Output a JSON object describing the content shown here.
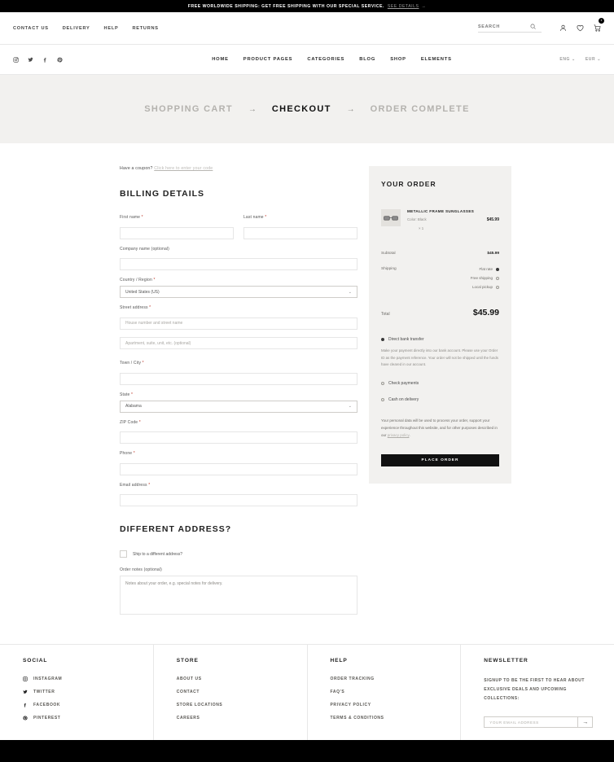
{
  "announcement": {
    "text": "FREE WORLDWIDE SHIPPING: GET FREE SHIPPING WITH OUR SPECIAL SERVICE.",
    "link": "SEE DETAILS",
    "arrow": "→"
  },
  "utility": {
    "links": [
      "CONTACT US",
      "DELIVERY",
      "HELP",
      "RETURNS"
    ],
    "search_placeholder": "SEARCH",
    "cart_count": "1"
  },
  "mainnav": {
    "social": [
      "instagram-icon",
      "twitter-icon",
      "facebook-icon",
      "pinterest-icon"
    ],
    "items": [
      "HOME",
      "PRODUCT PAGES",
      "CATEGORIES",
      "BLOG",
      "SHOP",
      "ELEMENTS"
    ],
    "language": "ENG",
    "currency": "EUR",
    "chevron": "⌄"
  },
  "steps": {
    "cart": "SHOPPING CART",
    "checkout": "CHECKOUT",
    "complete": "ORDER COMPLETE",
    "arrow": "→"
  },
  "coupon": {
    "prompt": "Have a coupon?",
    "link": "Click here to enter your code"
  },
  "billing": {
    "heading": "BILLING DETAILS",
    "first_name_label": "First name",
    "last_name_label": "Last name",
    "company_label": "Company name (optional)",
    "country_label": "Country / Region",
    "country_value": "United States (US)",
    "street_label": "Street address",
    "street1_placeholder": "House number and street name",
    "street2_placeholder": "Apartment, suite, unit, etc. (optional)",
    "city_label": "Town / City",
    "state_label": "State",
    "state_value": "Alabama",
    "zip_label": "ZIP Code",
    "phone_label": "Phone",
    "email_label": "Email address",
    "required_mark": "*"
  },
  "different_address": {
    "heading": "DIFFERENT ADDRESS?",
    "ship_label": "Ship to a different address?",
    "notes_label": "Order notes (optional)",
    "notes_placeholder": "Notes about your order, e.g. special notes for delivery."
  },
  "order": {
    "heading": "YOUR ORDER",
    "product": {
      "title": "METALLIC FRAME SUNGLASSES",
      "color": "Color: Black",
      "quantity": "× 1",
      "price": "$45.99"
    },
    "subtotal_label": "Subtotal",
    "subtotal_value": "$45.99",
    "shipping_label": "Shipping",
    "shipping_options": [
      {
        "label": "Flat rate",
        "selected": true
      },
      {
        "label": "Free shipping",
        "selected": false
      },
      {
        "label": "Local pickup",
        "selected": false
      }
    ],
    "total_label": "Total",
    "total_value": "$45.99",
    "payment_methods": [
      {
        "label": "Direct bank transfer",
        "selected": true
      },
      {
        "label": "Check payments",
        "selected": false
      },
      {
        "label": "Cash on delivery",
        "selected": false
      }
    ],
    "payment_description": "Make your payment directly into our bank account. Please use your Order ID as the payment reference. Your order will not be shipped until the funds have cleared in our account.",
    "privacy_text": "Your personal data will be used to process your order, support your experience throughout this website, and for other purposes described in our",
    "privacy_link": "privacy policy",
    "privacy_tail": ".",
    "place_order": "PLACE ORDER"
  },
  "footer": {
    "social": {
      "title": "SOCIAL",
      "items": [
        {
          "label": "INSTAGRAM",
          "icon": "instagram-icon"
        },
        {
          "label": "TWITTER",
          "icon": "twitter-icon"
        },
        {
          "label": "FACEBOOK",
          "icon": "facebook-icon"
        },
        {
          "label": "PINTEREST",
          "icon": "pinterest-icon"
        }
      ]
    },
    "store": {
      "title": "STORE",
      "items": [
        "ABOUT US",
        "CONTACT",
        "STORE LOCATIONS",
        "CAREERS"
      ]
    },
    "help": {
      "title": "HELP",
      "items": [
        "ORDER TRACKING",
        "FAQ'S",
        "PRIVACY POLICY",
        "TERMS & CONDITIONS"
      ]
    },
    "newsletter": {
      "title": "NEWSLETTER",
      "text": "SIGNUP TO BE THE FIRST TO HEAR ABOUT EXCLUSIVE DEALS AND UPCOMING COLLECTIONS:",
      "placeholder": "YOUR EMAIL ADDRESS",
      "submit": "→"
    }
  },
  "colors": {
    "accent": "#000000",
    "panel": "#f2f1ef",
    "required": "#c0392b"
  }
}
